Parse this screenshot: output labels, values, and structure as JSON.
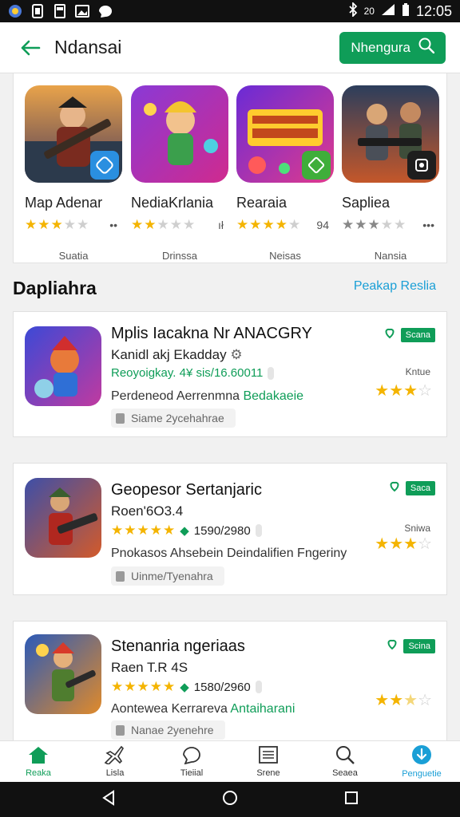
{
  "status_bar": {
    "signal": "20",
    "time": "12:05"
  },
  "header": {
    "title": "Ndansai",
    "action_label": "Nhengura"
  },
  "carousel": [
    {
      "name": "Map Adenar",
      "more": "••",
      "caption": "Suatia",
      "rating": 3,
      "star_color": "gold",
      "icon": "controller-badge-icon"
    },
    {
      "name": "NediaKrlania",
      "more": "ıł",
      "caption": "Drinssa",
      "rating": 2,
      "star_color": "gold",
      "icon": "star-badge-icon"
    },
    {
      "name": "Rearaia",
      "more": "94",
      "caption": "Neisas",
      "rating": 4,
      "star_color": "gold",
      "icon": "shield-badge-icon"
    },
    {
      "name": "Sapliea",
      "more": "•••",
      "caption": "Nansia",
      "rating": 3,
      "star_color": "grey",
      "icon": "camera-badge-icon"
    }
  ],
  "section": {
    "title": "Dapliahra",
    "link": "Peakap Reslia"
  },
  "list": [
    {
      "title": "Mplis Iacakna Nr ANACGRY",
      "subtitle": "Kanidl akj Ekadday",
      "meta": "Reoyoigkay. 4¥ sis/16.60011",
      "show_line_stars": false,
      "desc_prefix": "Perdeneod Aerrenmna ",
      "desc_green": "Bedakaeie",
      "pill": "Siame 2ycehahrae",
      "tag": "Scana",
      "cap": "Kntue",
      "rating": 3
    },
    {
      "title": "Geopesor Sertanjaric",
      "subtitle": "Roen'6O3.4",
      "meta": "1590/2980",
      "show_line_stars": true,
      "desc_prefix": "Pnokasos Ahsebein Deindalifien Fngeriny",
      "desc_green": "",
      "pill": "Uinme/Tyenahra",
      "tag": "Saca",
      "cap": "Sniwa",
      "rating": 3
    },
    {
      "title": "Stenanria ngeriaas",
      "subtitle": "Raen T.R 4S",
      "meta": "1580/2960",
      "show_line_stars": true,
      "desc_prefix": "Aontewea Kerrareva ",
      "desc_green": "Antaiharani",
      "pill": "Nanae 2yenehre",
      "tag": "Scina",
      "cap": "",
      "rating": 2.5
    }
  ],
  "bottom_nav": [
    {
      "label": "Reaka",
      "icon": "home-icon",
      "active": "green"
    },
    {
      "label": "Lisla",
      "icon": "plane-icon",
      "active": ""
    },
    {
      "label": "Tieiial",
      "icon": "chat-icon",
      "active": ""
    },
    {
      "label": "Srene",
      "icon": "list-icon",
      "active": ""
    },
    {
      "label": "Seaea",
      "icon": "search-icon",
      "active": ""
    },
    {
      "label": "Penguetie",
      "icon": "download-icon",
      "active": "blue"
    }
  ],
  "colors": {
    "accent_green": "#0f9d58",
    "accent_blue": "#1a9fd6",
    "star": "#f4b400"
  }
}
